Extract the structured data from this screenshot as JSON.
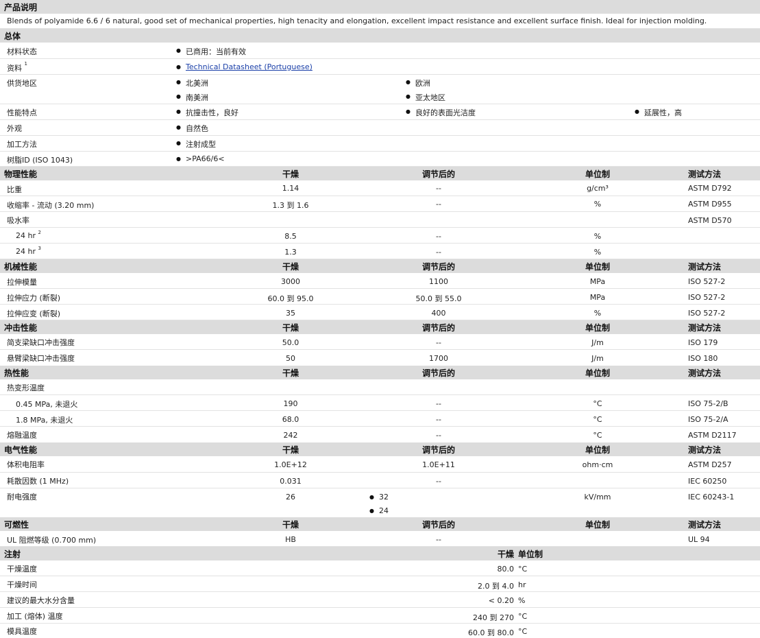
{
  "sections": {
    "desc_title": "产品说明",
    "desc_text": "Blends of polyamide 6.6 / 6 natural, good set of mechanical properties, high tenacity and elongation, excellent impact resistance and excellent surface finish. Ideal for injection molding.",
    "general": "总体",
    "physical": "物理性能",
    "mechanical": "机械性能",
    "impact": "冲击性能",
    "thermal": "热性能",
    "electrical": "电气性能",
    "flammability": "可燃性",
    "injection": "注射"
  },
  "cols": {
    "dry": "干燥",
    "cond": "调节后的",
    "unit": "单位制",
    "method": "测试方法"
  },
  "general": {
    "status_label": "材料状态",
    "status_value": "已商用：当前有效",
    "docs_label": "资料",
    "docs_sup": "1",
    "docs_link": "Technical Datasheet (Portuguese)",
    "region_label": "供货地区",
    "region_1": "北美洲",
    "region_2": "欧洲",
    "region_3": "南美洲",
    "region_4": "亚太地区",
    "feature_label": "性能特点",
    "feature_1": "抗撞击性，良好",
    "feature_2": "良好的表面光洁度",
    "feature_3": "延展性，高",
    "appearance_label": "外观",
    "appearance_value": "自然色",
    "process_label": "加工方法",
    "process_value": "注射成型",
    "resin_label": "树脂ID (ISO 1043)",
    "resin_value": ">PA66/6<"
  },
  "physical": {
    "r1": {
      "label": "比重",
      "dry": "1.14",
      "cond": "--",
      "unit": "g/cm³",
      "method": "ASTM D792"
    },
    "r2": {
      "label": "收缩率 - 流动 (3.20 mm)",
      "dry": "1.3 到 1.6",
      "cond": "--",
      "unit": "%",
      "method": "ASTM D955"
    },
    "r3": {
      "label": "吸水率",
      "method": "ASTM D570"
    },
    "r4": {
      "label": "24 hr",
      "sup": "2",
      "dry": "8.5",
      "cond": "--",
      "unit": "%"
    },
    "r5": {
      "label": "24 hr",
      "sup": "3",
      "dry": "1.3",
      "cond": "--",
      "unit": "%"
    }
  },
  "mechanical": {
    "r1": {
      "label": "拉伸模量",
      "dry": "3000",
      "cond": "1100",
      "unit": "MPa",
      "method": "ISO 527-2"
    },
    "r2": {
      "label": "拉伸应力 (断裂)",
      "dry": "60.0 到 95.0",
      "cond": "50.0 到 55.0",
      "unit": "MPa",
      "method": "ISO 527-2"
    },
    "r3": {
      "label": "拉伸应变 (断裂)",
      "dry": "35",
      "cond": "400",
      "unit": "%",
      "method": "ISO 527-2"
    }
  },
  "impact": {
    "r1": {
      "label": "简支梁缺口冲击强度",
      "dry": "50.0",
      "cond": "--",
      "unit": "J/m",
      "method": "ISO 179"
    },
    "r2": {
      "label": "悬臂梁缺口冲击强度",
      "dry": "50",
      "cond": "1700",
      "unit": "J/m",
      "method": "ISO 180"
    }
  },
  "thermal": {
    "r1": {
      "label": "热变形温度"
    },
    "r2": {
      "label": "0.45 MPa, 未退火",
      "dry": "190",
      "cond": "--",
      "unit": "°C",
      "method": "ISO 75-2/B"
    },
    "r3": {
      "label": "1.8 MPa, 未退火",
      "dry": "68.0",
      "cond": "--",
      "unit": "°C",
      "method": "ISO 75-2/A"
    },
    "r4": {
      "label": "熔融温度",
      "dry": "242",
      "cond": "--",
      "unit": "°C",
      "method": "ASTM D2117"
    }
  },
  "electrical": {
    "r1": {
      "label": "体积电阻率",
      "dry": "1.0E+12",
      "cond": "1.0E+11",
      "unit": "ohm·cm",
      "method": "ASTM D257"
    },
    "r2": {
      "label": "耗散因数 (1 MHz)",
      "dry": "0.031",
      "cond": "--",
      "method": "IEC 60250"
    },
    "r3": {
      "label": "耐电强度",
      "dry": "26",
      "cond_1": "32",
      "cond_2": "24",
      "unit": "kV/mm",
      "method": "IEC 60243-1"
    }
  },
  "flammability": {
    "r1": {
      "label": "UL 阻燃等级 (0.700 mm)",
      "dry": "HB",
      "cond": "--",
      "method": "UL 94"
    }
  },
  "injection": {
    "r1": {
      "label": "干燥温度",
      "dry": "80.0",
      "unit": "°C"
    },
    "r2": {
      "label": "干燥时间",
      "dry": "2.0 到 4.0",
      "unit": "hr"
    },
    "r3": {
      "label": "建议的最大水分含量",
      "dry": "< 0.20",
      "unit": "%"
    },
    "r4": {
      "label": "加工 (熔体) 温度",
      "dry": "240 到 270",
      "unit": "°C"
    },
    "r5": {
      "label": "模具温度",
      "dry": "60.0 到 80.0",
      "unit": "°C"
    }
  }
}
